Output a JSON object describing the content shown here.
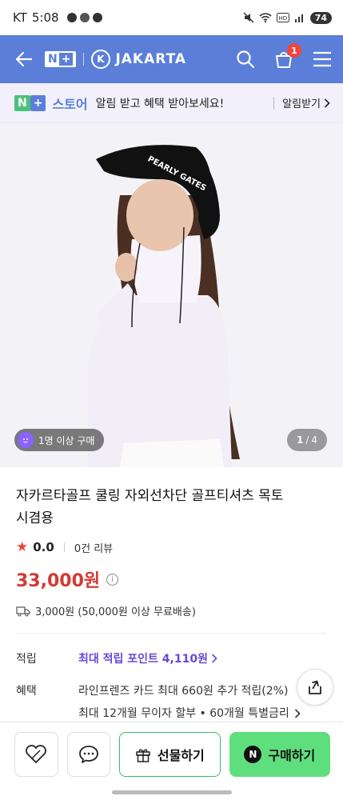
{
  "status_bar": {
    "carrier": "KT",
    "time": "5:08",
    "battery": "74"
  },
  "header": {
    "np_text": "N",
    "np_plus": "+",
    "store_name": "JAKARTA",
    "store_initial": "K",
    "cart_count": "1",
    "colors": {
      "header_bg": "#5b7fd8",
      "badge": "#f0453a"
    }
  },
  "promo": {
    "np_text": "N",
    "np_plus": "+",
    "store_label": "스토어",
    "message": "알림 받고 혜택 받아보세요!",
    "action": "알림받기"
  },
  "image": {
    "badge_text": "1명 이상 구매",
    "counter_current": "1",
    "counter_sep": "/",
    "counter_total": "4",
    "hat_text": "PEARLY GATES"
  },
  "product": {
    "title": "자카르타골프 쿨링 자외선차단 골프티셔츠 목토시겸용",
    "rating": "0.0",
    "reviews": "0건 리뷰",
    "price": "33,000원",
    "shipping": "3,000원 (50,000원 이상 무료배송)"
  },
  "details": {
    "points_label": "적립",
    "points_text": "최대 적립 포인트 4,110원",
    "benefit_label": "혜택",
    "benefit_line1": "라인프렌즈 카드 최대 660원 추가 적립(2%)",
    "benefit_line2": "최대 12개월 무이자 할부 • 60개월 특별금리"
  },
  "bottom": {
    "gift_label": "선물하기",
    "buy_label": "구매하기",
    "buy_icon": "N",
    "colors": {
      "buy_bg": "#5fde7e",
      "gift_border": "#3cb963"
    }
  }
}
